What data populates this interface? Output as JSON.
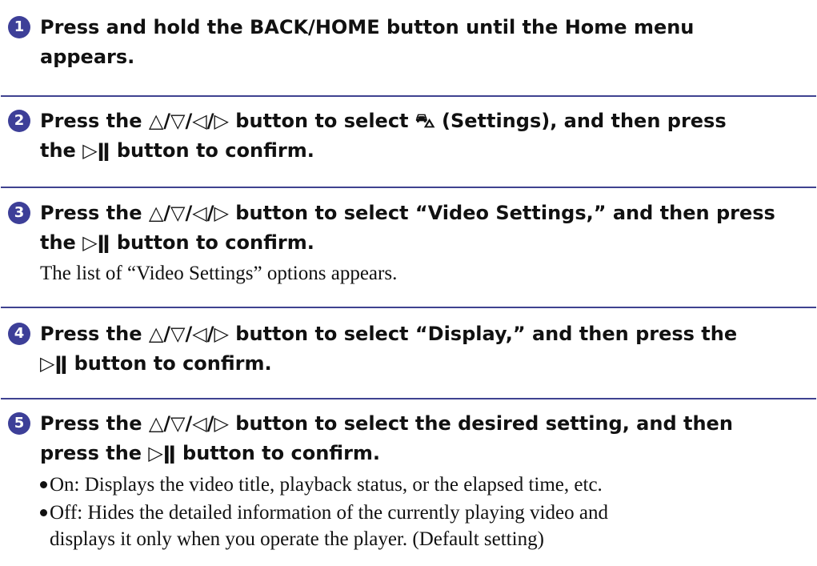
{
  "steps": [
    {
      "number": "1",
      "heading_lines": [
        "Press and hold the BACK/HOME button until the Home menu",
        "appears."
      ]
    },
    {
      "number": "2",
      "heading_lines": [
        "Press the △/▽/◁/▷ button to select ⛍ (Settings), and then press",
        "the ▷ǁ button to confirm."
      ]
    },
    {
      "number": "3",
      "heading_lines": [
        "Press the △/▽/◁/▷ button to select “Video Settings,” and then press",
        "the ▷ǁ button to confirm."
      ],
      "body": "The list of “Video Settings” options appears."
    },
    {
      "number": "4",
      "heading_lines": [
        "Press the △/▽/◁/▷ button to select “Display,” and then press the",
        "▷ǁ button to confirm."
      ]
    },
    {
      "number": "5",
      "heading_lines": [
        "Press the △/▽/◁/▷ button to select the desired setting, and then",
        "press the ▷ǁ button to confirm."
      ],
      "options": [
        {
          "lines": [
            "On: Displays the video title, playback status, or the elapsed time, etc."
          ]
        },
        {
          "lines": [
            "Off: Hides the detailed information of the currently playing video and",
            "displays it only when you operate the player. (Default setting)"
          ]
        }
      ]
    }
  ],
  "accent_color": "#3d3f98"
}
